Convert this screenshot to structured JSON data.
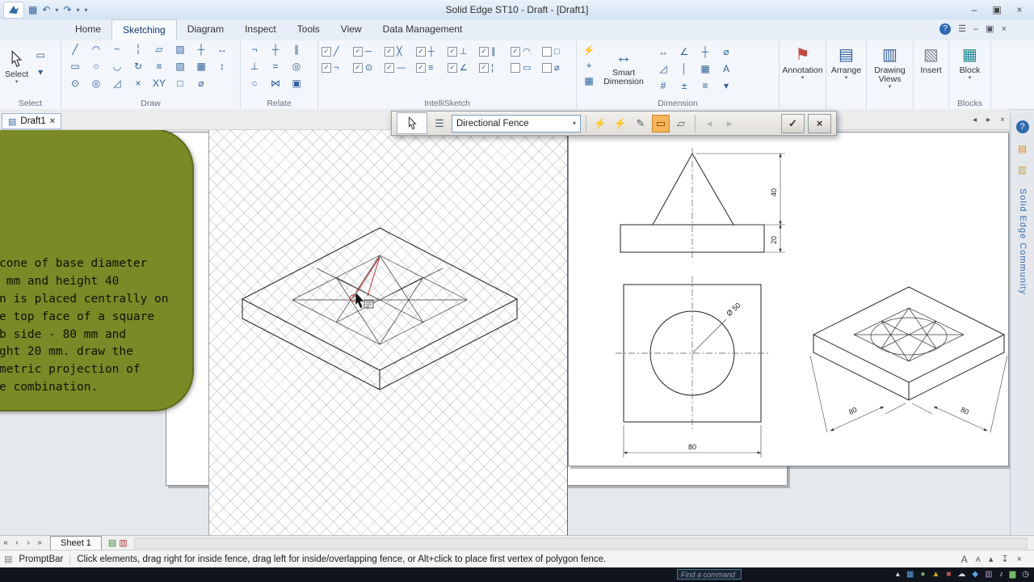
{
  "glyphs": {
    "caret": "▾"
  },
  "colors": {
    "accent": "#2e5f9e",
    "callout_bg": "#7a8a26",
    "fence_active": "#f6b559",
    "taskbar_bg": "#10141d"
  },
  "window": {
    "title": "Solid Edge ST10 - Draft - [Draft1]",
    "controls": [
      {
        "name": "minimize-button",
        "glyph": "–"
      },
      {
        "name": "restore-button",
        "glyph": "▣"
      },
      {
        "name": "close-button",
        "glyph": "×"
      }
    ]
  },
  "quick_access": [
    {
      "name": "save-icon",
      "glyph": "▦"
    },
    {
      "name": "undo-icon",
      "glyph": "↶"
    },
    {
      "name": "undo-caret-icon",
      "glyph": "▾"
    },
    {
      "name": "redo-icon",
      "glyph": "↷"
    },
    {
      "name": "redo-caret-icon",
      "glyph": "▾"
    },
    {
      "name": "customize-quick-access-icon",
      "glyph": "▾"
    }
  ],
  "tabs_row": {
    "tabs": [
      {
        "name": "tab-home",
        "label": "Home",
        "active": false
      },
      {
        "name": "tab-sketching",
        "label": "Sketching",
        "active": true
      },
      {
        "name": "tab-diagram",
        "label": "Diagram",
        "active": false
      },
      {
        "name": "tab-inspect",
        "label": "Inspect",
        "active": false
      },
      {
        "name": "tab-tools",
        "label": "Tools",
        "active": false
      },
      {
        "name": "tab-view",
        "label": "View",
        "active": false
      },
      {
        "name": "tab-data-management",
        "label": "Data Management",
        "active": false
      }
    ],
    "right_icons": [
      {
        "name": "help-icon",
        "glyph": "?"
      },
      {
        "name": "ribbon-options-icon",
        "glyph": "☰"
      },
      {
        "name": "doc-minimize-icon",
        "glyph": "–"
      },
      {
        "name": "doc-restore-icon",
        "glyph": "▣"
      },
      {
        "name": "doc-close-icon",
        "glyph": "×"
      }
    ]
  },
  "ribbon": {
    "select": {
      "group_label": "Select",
      "button_label": "Select",
      "side_icons": [
        {
          "name": "select-options-icon",
          "glyph": "▭"
        },
        {
          "name": "select-more-icon",
          "glyph": "▾"
        }
      ]
    },
    "draw": {
      "label": "Draw",
      "row1": [
        {
          "name": "line-icon",
          "glyph": "╱"
        },
        {
          "name": "tangent-arc-icon",
          "glyph": "◠"
        },
        {
          "name": "curve-icon",
          "glyph": "~"
        },
        {
          "name": "construction-icon",
          "glyph": "╎"
        },
        {
          "name": "copy-icon",
          "glyph": "▱"
        },
        {
          "name": "hatch-icon",
          "glyph": "▨"
        },
        {
          "name": "grid-icon",
          "glyph": "┼"
        },
        {
          "name": "move-icon",
          "glyph": "↔"
        }
      ],
      "row2": [
        {
          "name": "rectangle-icon",
          "glyph": "▭"
        },
        {
          "name": "circle-icon",
          "glyph": "○"
        },
        {
          "name": "arc-3pt-icon",
          "glyph": "◡"
        },
        {
          "name": "rotate-icon",
          "glyph": "↻"
        },
        {
          "name": "offset-icon",
          "glyph": "≡"
        },
        {
          "name": "fill-icon",
          "glyph": "▧"
        },
        {
          "name": "pattern-icon",
          "glyph": "▦"
        },
        {
          "name": "scale-icon",
          "glyph": "↕"
        }
      ],
      "row3": [
        {
          "name": "circle-tangent-icon",
          "glyph": "⊙"
        },
        {
          "name": "ellipse-icon",
          "glyph": "◎"
        },
        {
          "name": "chamfer-icon",
          "glyph": "◿"
        },
        {
          "name": "trim-icon",
          "glyph": "×"
        },
        {
          "name": "xy-keyin-icon",
          "glyph": "XY"
        },
        {
          "name": "zone-icon",
          "glyph": "□"
        },
        {
          "name": "diameter-icon",
          "glyph": "⌀"
        }
      ]
    },
    "relate": {
      "label": "Relate",
      "row1": [
        {
          "name": "connect-icon",
          "glyph": "¬"
        },
        {
          "name": "horizontal-vertical-icon",
          "glyph": "┼"
        },
        {
          "name": "parallel-icon",
          "glyph": "∥"
        }
      ],
      "row2": [
        {
          "name": "perpendicular-icon",
          "glyph": "⊥"
        },
        {
          "name": "equal-icon",
          "glyph": "="
        },
        {
          "name": "concentric-icon",
          "glyph": "◎"
        }
      ],
      "row3": [
        {
          "name": "tangent-relation-icon",
          "glyph": "○"
        },
        {
          "name": "symmetric-icon",
          "glyph": "⋈"
        },
        {
          "name": "lock-icon",
          "glyph": "▣"
        }
      ]
    },
    "intellisketch": {
      "label": "IntelliSketch",
      "row1": [
        {
          "name": "is-endpoint",
          "glyph": "╱",
          "checked": true
        },
        {
          "name": "is-midpoint",
          "glyph": "─",
          "checked": true
        },
        {
          "name": "is-intersection",
          "glyph": "╳",
          "checked": true
        },
        {
          "name": "is-horizontal-vertical",
          "glyph": "┼",
          "checked": true
        },
        {
          "name": "is-perpendicular",
          "glyph": "⊥",
          "checked": true
        },
        {
          "name": "is-parallel",
          "glyph": "∥",
          "checked": true
        },
        {
          "name": "is-tangent",
          "glyph": "◠",
          "checked": true
        },
        {
          "name": "is-point-on-element",
          "glyph": "□",
          "checked": false
        }
      ],
      "row2": [
        {
          "name": "is-connect",
          "glyph": "¬",
          "checked": true
        },
        {
          "name": "is-center",
          "glyph": "⊙",
          "checked": true
        },
        {
          "name": "is-edge",
          "glyph": "—",
          "checked": true
        },
        {
          "name": "is-offset",
          "glyph": "≡",
          "checked": true
        },
        {
          "name": "is-angle",
          "glyph": "∠",
          "checked": true
        },
        {
          "name": "is-reference",
          "glyph": "¦",
          "checked": true
        },
        {
          "name": "is-frame",
          "glyph": "▭",
          "checked": false
        },
        {
          "name": "is-diameter",
          "glyph": "⌀",
          "checked": false
        }
      ]
    },
    "dimension": {
      "label": "Dimension",
      "stack": [
        {
          "name": "relationship-assistant-icon",
          "glyph": "⚡"
        },
        {
          "name": "maintain-relationships-icon",
          "glyph": "+"
        },
        {
          "name": "relationship-colors-icon",
          "glyph": "▦"
        }
      ],
      "smart": {
        "label": "Smart Dimension",
        "glyph": "↔"
      },
      "row1": [
        {
          "name": "distance-between-icon",
          "glyph": "↔"
        },
        {
          "name": "angle-between-icon",
          "glyph": "∠"
        },
        {
          "name": "coordinate-dimension-icon",
          "glyph": "┼"
        },
        {
          "name": "symmetric-diameter-icon",
          "glyph": "⌀"
        }
      ],
      "row2": [
        {
          "name": "chamfer-dimension-icon",
          "glyph": "◿"
        },
        {
          "name": "dimension-axis-icon",
          "glyph": "│"
        },
        {
          "name": "auto-dimension-icon",
          "glyph": "▦"
        },
        {
          "name": "dimension-style-icon",
          "glyph": "A"
        }
      ],
      "row3": [
        {
          "name": "dimension-prefix-icon",
          "glyph": "#"
        },
        {
          "name": "edit-dimension-icon",
          "glyph": "±"
        },
        {
          "name": "align-dimension-icon",
          "glyph": "≡"
        },
        {
          "name": "more-dimensions-icon",
          "glyph": "▾"
        }
      ]
    },
    "big_buttons": [
      {
        "name": "annotation-button",
        "label": "Annotation",
        "glyph": "⚑",
        "caret": "▾",
        "group_label": ""
      },
      {
        "name": "arrange-button",
        "label": "Arrange",
        "glyph": "▤",
        "caret": "▾",
        "group_label": ""
      },
      {
        "name": "drawing-views-button",
        "label": "Drawing Views",
        "glyph": "▥",
        "caret": "▾",
        "group_label": ""
      },
      {
        "name": "insert-button",
        "label": "Insert",
        "glyph": "▧",
        "caret": "",
        "group_label": ""
      },
      {
        "name": "block-button",
        "label": "Block",
        "glyph": "▦",
        "caret": "▾",
        "group_label": "Blocks"
      }
    ]
  },
  "command_bar": {
    "dropdown_value": "Directional Fence",
    "list_icon": {
      "name": "options-list-icon",
      "glyph": "☰"
    },
    "fence_icons": [
      {
        "name": "fence-inside-icon",
        "glyph": "⚡",
        "state": "normal"
      },
      {
        "name": "fence-overlapping-icon",
        "glyph": "⚡",
        "state": "normal"
      },
      {
        "name": "fence-draw-icon",
        "glyph": "✎",
        "state": "normal"
      },
      {
        "name": "fence-rectangle-icon",
        "glyph": "▭",
        "state": "active"
      },
      {
        "name": "fence-polygon-icon",
        "glyph": "▱",
        "state": "normal"
      }
    ],
    "nav_icons": [
      {
        "name": "previous-icon",
        "glyph": "◂",
        "state": "disabled"
      },
      {
        "name": "next-icon",
        "glyph": "▸",
        "state": "disabled"
      }
    ],
    "accept_glyph": "✓",
    "cancel_glyph": "×"
  },
  "doc_strip": {
    "tab": {
      "icon_glyph": "▤",
      "label": "Draft1",
      "close_glyph": "×"
    },
    "right_icons": [
      {
        "name": "tab-scroll-left-icon",
        "glyph": "◂"
      },
      {
        "name": "tab-scroll-right-icon",
        "glyph": "▸"
      },
      {
        "name": "close-view-icon",
        "glyph": "×"
      }
    ]
  },
  "callout": {
    "lines": [
      "cone of base diameter",
      " mm and height 40",
      "n is placed centrally on",
      "e top face of a square",
      "b side - 80 mm and",
      "ght 20 mm. draw the",
      "metric projection of",
      "e combination."
    ]
  },
  "drawing": {
    "front": {
      "cone_height": "40",
      "slab_height": "20"
    },
    "top": {
      "side": "80",
      "diameter": "Ø 50"
    },
    "iso": {
      "dim_left": "80",
      "dim_right": "80"
    }
  },
  "sheet_bar": {
    "nav": [
      {
        "name": "first-sheet-icon",
        "glyph": "«"
      },
      {
        "name": "prev-sheet-icon",
        "glyph": "‹"
      },
      {
        "name": "next-sheet-icon",
        "glyph": "›"
      },
      {
        "name": "last-sheet-icon",
        "glyph": "»"
      }
    ],
    "tab_label": "Sheet 1",
    "icons": [
      {
        "name": "sheet-setup-icon",
        "glyph": "▤"
      },
      {
        "name": "background-sheet-icon",
        "glyph": "▥"
      }
    ]
  },
  "prompt_bar": {
    "icon_glyph": "▤",
    "label": "PromptBar",
    "message": "Click elements, drag right for inside fence, drag left for inside/overlapping fence, or Alt+click to place first vertex of polygon fence.",
    "right_icons": [
      {
        "name": "font-size-large-icon",
        "glyph": "A"
      },
      {
        "name": "font-size-small-icon",
        "glyph": "A"
      },
      {
        "name": "dock-icon",
        "glyph": "▴"
      },
      {
        "name": "autohide-pin-icon",
        "glyph": "↧"
      },
      {
        "name": "close-promptbar-icon",
        "glyph": "×"
      }
    ]
  },
  "taskbar": {
    "search_placeholder": "Find a command",
    "tray": [
      {
        "name": "tray-show-hidden-icon",
        "glyph": "▴"
      },
      {
        "name": "tray-app1-icon",
        "glyph": "▦"
      },
      {
        "name": "tray-app2-icon",
        "glyph": "●"
      },
      {
        "name": "tray-app3-icon",
        "glyph": "▲"
      },
      {
        "name": "tray-app4-icon",
        "glyph": "■"
      },
      {
        "name": "tray-cloud-icon",
        "glyph": "☁"
      },
      {
        "name": "tray-app5-icon",
        "glyph": "◆"
      },
      {
        "name": "tray-app6-icon",
        "glyph": "▥"
      },
      {
        "name": "tray-volume-icon",
        "glyph": "♪"
      },
      {
        "name": "tray-network-icon",
        "glyph": "▆"
      },
      {
        "name": "tray-clock-icon",
        "glyph": "◷"
      }
    ]
  },
  "side_panel": {
    "help_glyph": "?",
    "icons": [
      {
        "name": "community-shortcut-icon",
        "glyph": "▤"
      },
      {
        "name": "bookmark-icon",
        "glyph": "▥"
      }
    ],
    "vertical_label": "Solid Edge Community"
  }
}
